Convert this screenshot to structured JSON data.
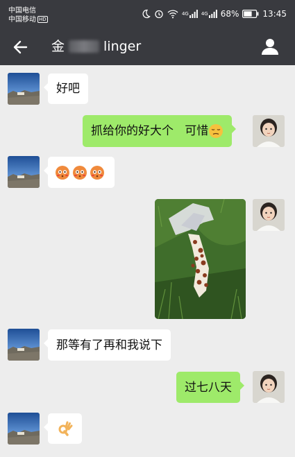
{
  "status_bar": {
    "carrier_1": "中国电信",
    "carrier_2": "中国移动",
    "hd_badge": "HD",
    "network_1": "4G",
    "network_2": "4G",
    "battery": "68%",
    "time": "13:45"
  },
  "header": {
    "contact_name_prefix": "金",
    "contact_name_suffix": "linger"
  },
  "messages": [
    {
      "side": "left",
      "type": "text",
      "text": "好吧"
    },
    {
      "side": "right",
      "type": "text",
      "text": "抓给你的好大个   可惜",
      "emoji": "pensive-face"
    },
    {
      "side": "left",
      "type": "emoji",
      "emoji": "flushed-face ×3"
    },
    {
      "side": "right",
      "type": "image",
      "description_icon": "photo"
    },
    {
      "side": "left",
      "type": "text",
      "text": "那等有了再和我说下"
    },
    {
      "side": "right",
      "type": "text",
      "text": "过七八天"
    },
    {
      "side": "left",
      "type": "emoji",
      "emoji": "ok-hand"
    }
  ],
  "colors": {
    "bar": "#393a3f",
    "background": "#ededed",
    "outgoing_bubble": "#9eea6a",
    "incoming_bubble": "#ffffff"
  }
}
